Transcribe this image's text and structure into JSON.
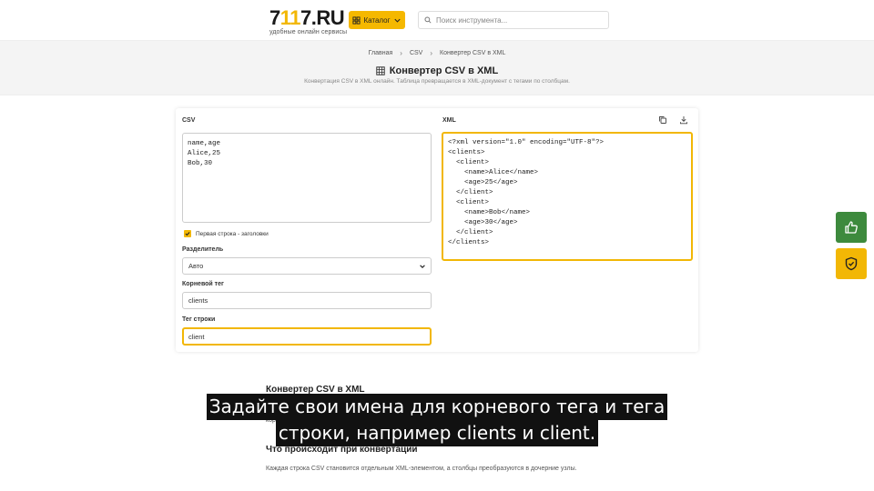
{
  "header": {
    "logo_prefix": "7",
    "logo_accent": "11",
    "logo_suffix": "7.RU",
    "logo_tagline": "удобные онлайн сервисы",
    "catalog_label": "Каталог",
    "search_placeholder": "Поиск инструмента..."
  },
  "breadcrumb": {
    "items": [
      "Главная",
      "CSV",
      "Конвертер CSV в XML"
    ]
  },
  "page": {
    "title": "Конвертер CSV в XML",
    "subtitle": "Конвертация CSV в XML онлайн. Таблица превращается в XML-документ с тегами по столбцам."
  },
  "converter": {
    "csv_label": "CSV",
    "csv_value": "name,age\nAlice,25\nBob,30",
    "header_checkbox_label": "Первая строка - заголовки",
    "header_checked": true,
    "delimiter_label": "Разделитель",
    "delimiter_value": "Авто",
    "root_tag_label": "Корневой тег",
    "root_tag_value": "clients",
    "row_tag_label": "Тег строки",
    "row_tag_value": "client",
    "xml_label": "XML",
    "xml_output": "<?xml version=\"1.0\" encoding=\"UTF-8\"?>\n<clients>\n  <client>\n    <name>Alice</name>\n    <age>25</age>\n  </client>\n  <client>\n    <name>Bob</name>\n    <age>30</age>\n  </client>\n</clients>"
  },
  "article": {
    "heading1": "Конвертер CSV в XML",
    "para1_fragment": "корпор",
    "heading2": "Что происходит при конвертации",
    "para2": "Каждая строка CSV становится отдельным XML-элементом, а столбцы преобразуются в дочерние узлы."
  },
  "caption": {
    "line1": "Задайте свои имена для корневого тега и тега",
    "line2": "строки, например clients и client."
  },
  "colors": {
    "accent": "#f2b705",
    "like_button": "#3d8a3d"
  },
  "icons": [
    "catalog-grid-icon",
    "chevron-down-icon",
    "search-icon",
    "table-icon",
    "copy-icon",
    "download-icon",
    "check-icon",
    "thumbs-up-icon",
    "shield-check-icon"
  ]
}
